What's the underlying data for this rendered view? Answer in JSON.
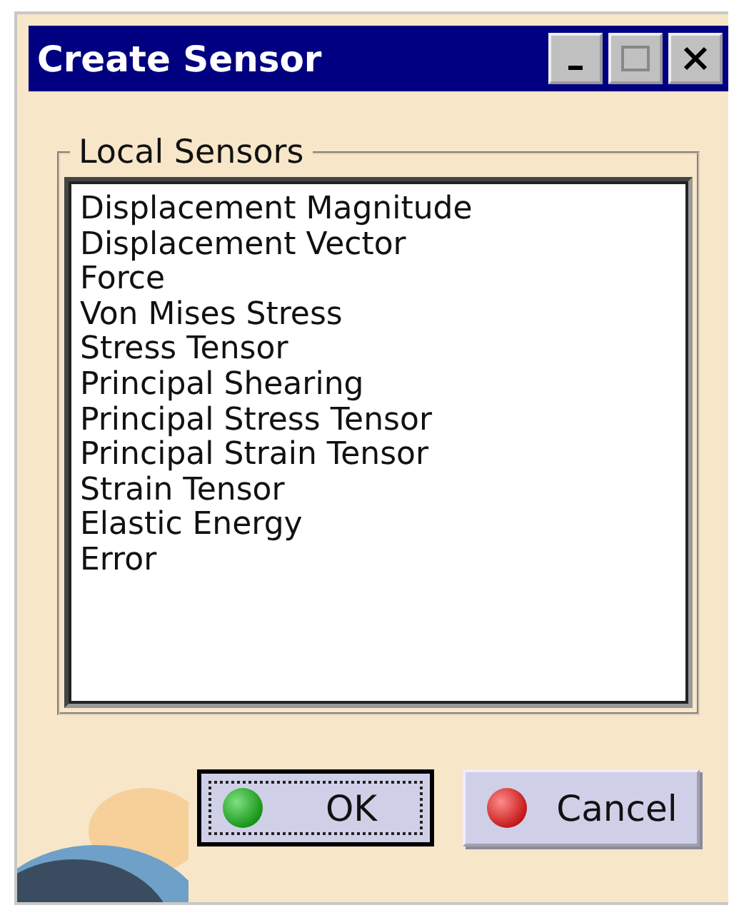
{
  "window": {
    "title": "Create Sensor"
  },
  "group": {
    "label": "Local Sensors"
  },
  "sensors": [
    {
      "label": "Displacement Magnitude"
    },
    {
      "label": "Displacement Vector"
    },
    {
      "label": "Force"
    },
    {
      "label": "Von Mises Stress"
    },
    {
      "label": "Stress Tensor"
    },
    {
      "label": "Principal Shearing"
    },
    {
      "label": "Principal Stress Tensor"
    },
    {
      "label": "Principal Strain Tensor"
    },
    {
      "label": "Strain Tensor"
    },
    {
      "label": "Elastic Energy"
    },
    {
      "label": "Error"
    }
  ],
  "buttons": [
    {
      "label": "OK",
      "kind": "ok",
      "focused": true
    },
    {
      "label": "Cancel",
      "kind": "cancel",
      "focused": false
    }
  ]
}
